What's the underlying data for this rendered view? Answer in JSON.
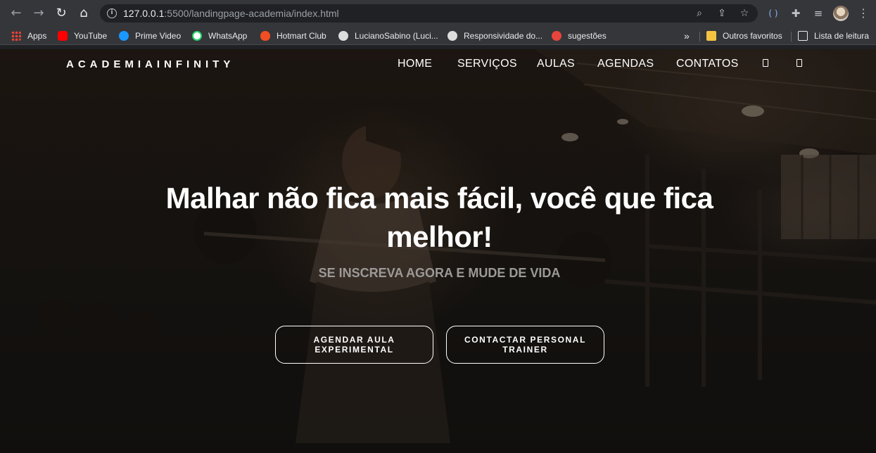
{
  "browser": {
    "url_host": "127.0.0.1",
    "url_rest": ":5500/landingpage-academia/index.html"
  },
  "bookmarks": [
    {
      "label": "Apps",
      "icon": "apps-grid-icon",
      "color": "#ea4335"
    },
    {
      "label": "YouTube",
      "icon": "youtube-icon",
      "color": "#ff0000"
    },
    {
      "label": "Prime Video",
      "icon": "prime-video-icon",
      "color": "#1a98ff"
    },
    {
      "label": "WhatsApp",
      "icon": "whatsapp-icon",
      "color": "#25d366"
    },
    {
      "label": "Hotmart Club",
      "icon": "hotmart-icon",
      "color": "#f04e23"
    },
    {
      "label": "LucianoSabino (Luci...",
      "icon": "github-icon",
      "color": "#dddddd"
    },
    {
      "label": "Responsividade do...",
      "icon": "github-icon",
      "color": "#dddddd"
    },
    {
      "label": "sugestões",
      "icon": "sugestoes-icon",
      "color": "#e8453c"
    }
  ],
  "bookmarks_overflow": "»",
  "bookmarks_right": [
    {
      "label": "Outros favoritos",
      "icon": "folder-icon",
      "color": "#f5c342"
    },
    {
      "label": "Lista de leitura",
      "icon": "reading-list-icon",
      "color": "#e8eaed"
    }
  ],
  "site": {
    "logo": "ACADEMIAINFINITY",
    "nav": [
      "HOME",
      "SERVIÇOS",
      "AULAS",
      "AGENDAS",
      "CONTATOS"
    ],
    "hero_title": "Malhar não fica mais fácil, você que fica melhor!",
    "hero_subtitle": "SE INSCREVA AGORA E MUDE DE VIDA",
    "cta_primary": "AGENDAR AULA\nEXPERIMENTAL",
    "cta_secondary": "CONTACTAR PERSONAL\nTRAINER"
  }
}
